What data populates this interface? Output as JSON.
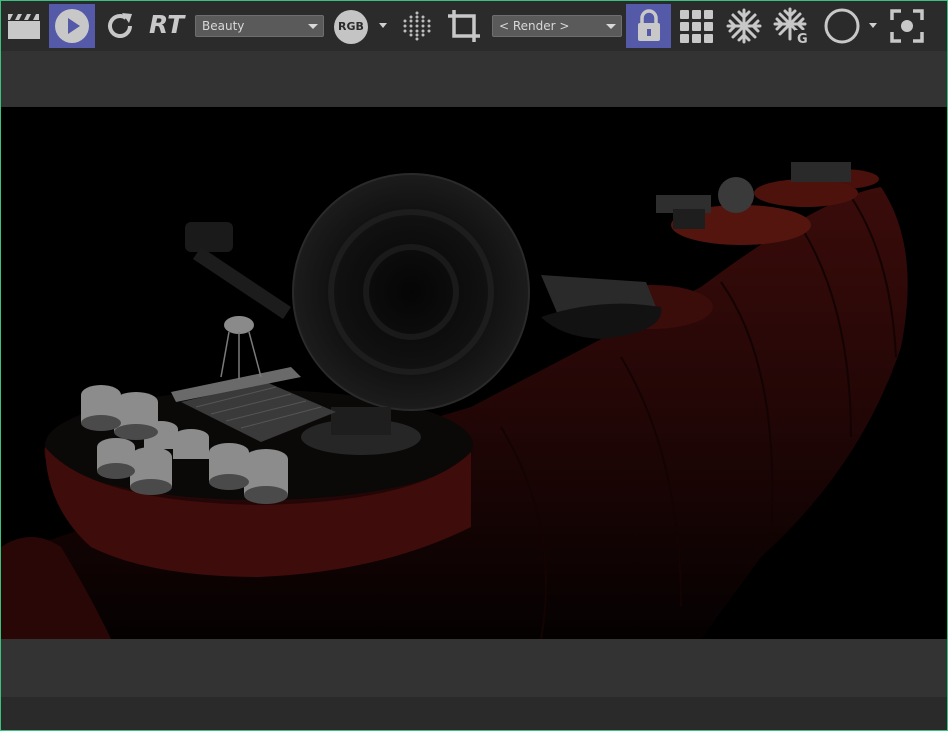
{
  "toolbar": {
    "clapper_icon": "clapperboard-icon",
    "play_icon": "play-icon",
    "refresh_icon": "refresh-icon",
    "rt_label": "RT",
    "channel_select": {
      "value": "Beauty"
    },
    "color_mode_label": "RGB",
    "sample_grid_icon": "dot-grid-icon",
    "crop_icon": "crop-icon",
    "camera_select": {
      "value": "< Render >"
    },
    "lock_icon": "lock-icon",
    "tile_grid_icon": "grid-icon",
    "freeze_icon": "snowflake-icon",
    "freeze_geometry_icon": "snowflake-g-icon",
    "circle_icon": "circle-icon",
    "focus_icon": "focus-target-icon"
  },
  "colors": {
    "accent_active": "#5459a8",
    "frame_border": "#37c37e",
    "toolbar_bg": "#2b2b2b",
    "band_bg": "#333333"
  }
}
